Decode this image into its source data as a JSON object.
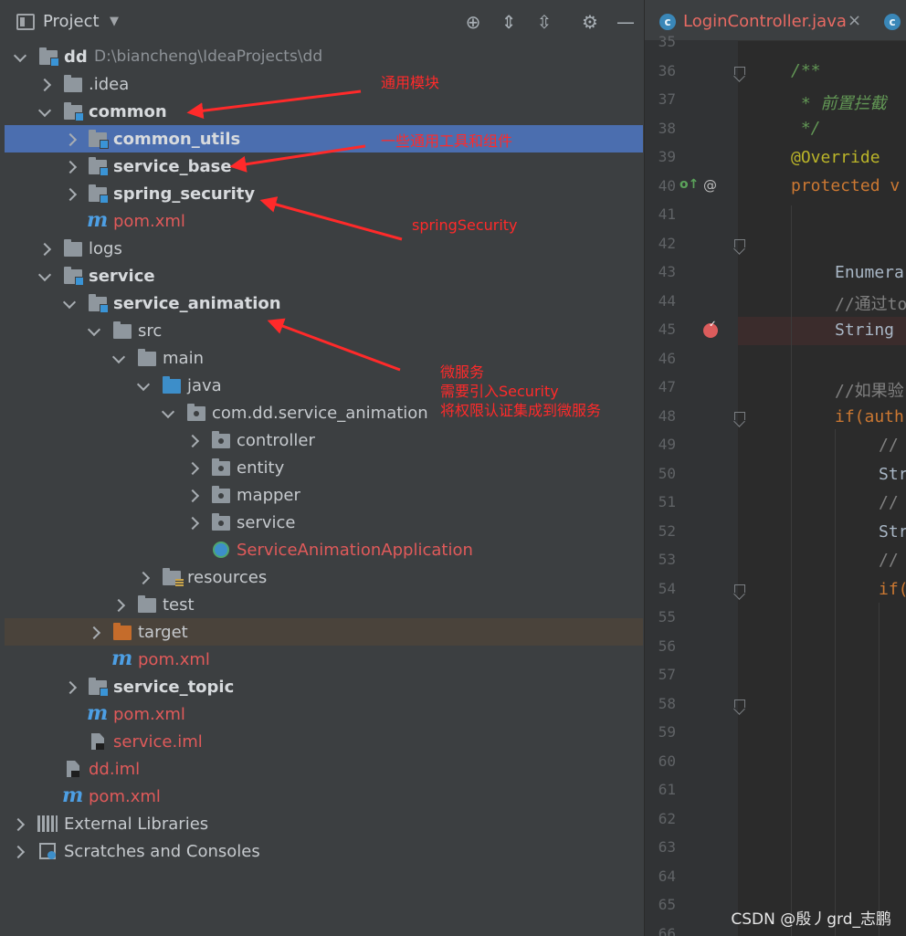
{
  "panel": {
    "title": "Project"
  },
  "tree": {
    "root_name": "dd",
    "root_path": "D:\\biancheng\\IdeaProjects\\dd",
    "idea": ".idea",
    "common": "common",
    "common_utils": "common_utils",
    "service_base": "service_base",
    "spring_security": "spring_security",
    "common_pom": "pom.xml",
    "logs": "logs",
    "service": "service",
    "service_animation": "service_animation",
    "src": "src",
    "main": "main",
    "java": "java",
    "package": "com.dd.service_animation",
    "controller": "controller",
    "entity": "entity",
    "mapper": "mapper",
    "service_pkg": "service",
    "app_class": "ServiceAnimationApplication",
    "resources": "resources",
    "test": "test",
    "target": "target",
    "anim_pom": "pom.xml",
    "service_topic": "service_topic",
    "service_pom": "pom.xml",
    "service_iml": "service.iml",
    "dd_iml": "dd.iml",
    "root_pom": "pom.xml",
    "external_libraries": "External Libraries",
    "scratches": "Scratches and Consoles"
  },
  "annotations": {
    "common_note": "通用模块",
    "tools_note": "一些通用工具和组件",
    "security_note": "springSecurity",
    "micro_line1": "微服务",
    "micro_line2": "需要引入Security",
    "micro_line3": "将权限认证集成到微服务"
  },
  "editor": {
    "tab_label": "LoginController.java",
    "tab_close": "×",
    "tab_icon_letter": "c",
    "lines": [
      "35",
      "36",
      "37",
      "38",
      "39",
      "40",
      "41",
      "42",
      "43",
      "44",
      "45",
      "46",
      "47",
      "48",
      "49",
      "50",
      "51",
      "52",
      "53",
      "54",
      "55",
      "56",
      "57",
      "58",
      "59",
      "60",
      "61",
      "62",
      "63",
      "64",
      "65",
      "66"
    ],
    "code": {
      "l36": "/**",
      "l37": " * 前置拦截",
      "l38": " */",
      "l39": "@Override",
      "l40": "protected v",
      "l43": "Enumera",
      "l44": "//通过to",
      "l45": "String",
      "l47": "//如果验",
      "l48": "if(auth",
      "l49": "//",
      "l50": "Str",
      "l51": "//",
      "l52": "Str",
      "l53": "//",
      "l54": "if("
    },
    "gutter_override": "o↑",
    "gutter_at": "@"
  },
  "watermark": "CSDN @殷丿grd_志鹏",
  "colors": {
    "selection": "#4b6eaf",
    "annotation": "#ff2a2a",
    "modified_file": "#e05a5a"
  }
}
